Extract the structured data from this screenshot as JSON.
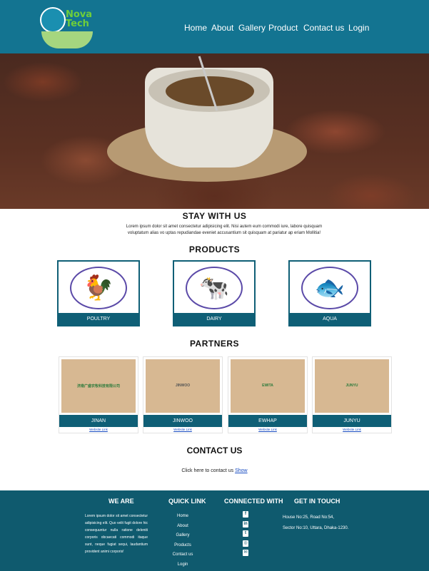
{
  "brand": {
    "logo_text_line1": "Nova",
    "logo_text_line2": "Tech"
  },
  "nav": {
    "items": [
      {
        "label": "Home"
      },
      {
        "label": "About"
      },
      {
        "label": "Gallery"
      },
      {
        "label": "Product"
      },
      {
        "label": "Contact us"
      },
      {
        "label": "Login"
      }
    ]
  },
  "stay": {
    "title": "STAY WITH US",
    "text": "Lorem ipsum dolor sit amet consectetur adipisicing elit. Nisi autem eum commodi iure, labore quisquam voluptatum alias vo uptas repudiandae eveniet accusantium sit quisquam at pariatur ap eriam Mollitia!"
  },
  "products": {
    "title": "PRODUCTS",
    "items": [
      {
        "label": "POULTRY",
        "icon": "rooster-icon",
        "glyph": "🐓"
      },
      {
        "label": "DAIRY",
        "icon": "cow-icon",
        "glyph": "🐄"
      },
      {
        "label": "AQUA",
        "icon": "fish-icon",
        "glyph": "🐟"
      }
    ]
  },
  "partners": {
    "title": "PARTNERS",
    "items": [
      {
        "label": "JINAN",
        "link": "Website Link",
        "logo_text": "济南广盛农牧科技有限公司"
      },
      {
        "label": "JINWOO",
        "link": "Website Link",
        "logo_text": "JINWOO"
      },
      {
        "label": "EWHAP",
        "link": "Website Link",
        "logo_text": "EWITA"
      },
      {
        "label": "JUNYU",
        "link": "Website Link",
        "logo_text": "JUNYU"
      }
    ]
  },
  "contact": {
    "title": "CONTACT US",
    "text": "Click here to contact us",
    "link": "Show"
  },
  "footer": {
    "weare_title": "WE ARE",
    "weare_text": "Lorem ipsum dolor sit amet consectetur adipisicing elit. Quo velit fugit dolore hic consequuntur nulla ratione deleniti corporis obcaecati commodi itaque sunt, neque fugiat sequi, laudantium provident animi corporis!",
    "quick_title": "QUICK LINK",
    "quick_links": [
      "Home",
      "About",
      "Gallery",
      "Products",
      "Contact us",
      "Login"
    ],
    "connect_title": "CONNECTED WITH",
    "social": [
      {
        "icon": "facebook-icon",
        "glyph": "f"
      },
      {
        "icon": "linkedin-icon",
        "glyph": "in"
      },
      {
        "icon": "twitter-icon",
        "glyph": "t"
      },
      {
        "icon": "instagram-icon",
        "glyph": "◎"
      },
      {
        "icon": "email-icon",
        "glyph": "✉"
      }
    ],
    "touch_title": "GET IN TOUCH",
    "address_line1": "House No:25, Road No:54,",
    "address_line2": "Sector No:10, Uttara, Dhaka-1230."
  },
  "colors": {
    "header": "#137491",
    "accent": "#0f5f76",
    "footer": "#0f5a6e"
  }
}
